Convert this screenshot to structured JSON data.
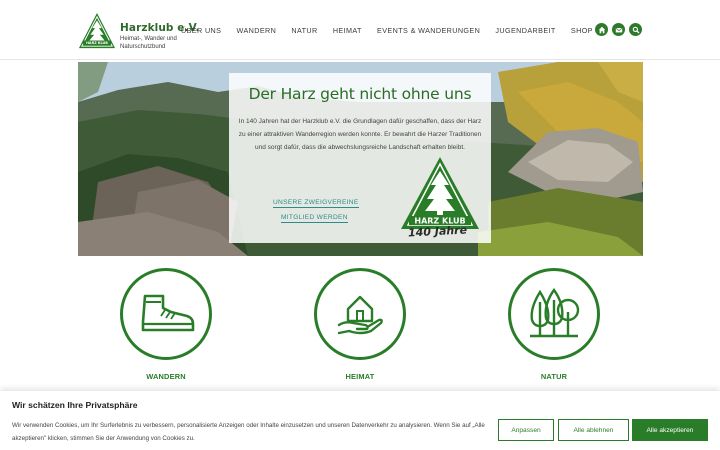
{
  "header": {
    "brand_name": "Harzklub e.V.",
    "brand_subtitle": "Heimat-, Wander und Naturschutzbund",
    "logo_text": "HARZ KLUB",
    "nav": [
      "ÜBER UNS",
      "WANDERN",
      "NATUR",
      "HEIMAT",
      "EVENTS & WANDERUNGEN",
      "JUGENDARBEIT",
      "SHOP"
    ],
    "icons": [
      "home-icon",
      "mail-icon",
      "search-icon"
    ]
  },
  "hero": {
    "title": "Der Harz geht nicht ohne uns",
    "text": "In 140 Jahren hat der Harzklub e.V. die Grundlagen dafür geschaffen, dass der Harz zu einer attraktiven Wanderregion werden konnte. Er bewahrt die Harzer Traditionen und sorgt dafür, dass die abwechslungsreiche Landschaft erhalten bleibt.",
    "link_1": "UNSERE ZWEIGVEREINE",
    "link_2": "MITGLIED WERDEN",
    "badge_text": "HARZ KLUB",
    "badge_caption": "140 Jahre"
  },
  "features": [
    {
      "label": "WANDERN",
      "icon": "hiking-boot-icon"
    },
    {
      "label": "HEIMAT",
      "icon": "house-in-hand-icon"
    },
    {
      "label": "NATUR",
      "icon": "trees-icon"
    }
  ],
  "cookie": {
    "title": "Wir schätzen Ihre Privatsphäre",
    "text": "Wir verwenden Cookies, um Ihr Surferlebnis zu verbessern, personalisierte Anzeigen oder Inhalte einzusetzen und unseren Datenverkehr zu analysieren. Wenn Sie auf „Alle akzeptieren\" klicken, stimmen Sie der Anwendung von Cookies zu.",
    "btn_customize": "Anpassen",
    "btn_reject": "Alle ablehnen",
    "btn_accept": "Alle akzeptieren"
  },
  "colors": {
    "brand_green": "#2a7d28",
    "link_teal": "#2e8b8b"
  }
}
